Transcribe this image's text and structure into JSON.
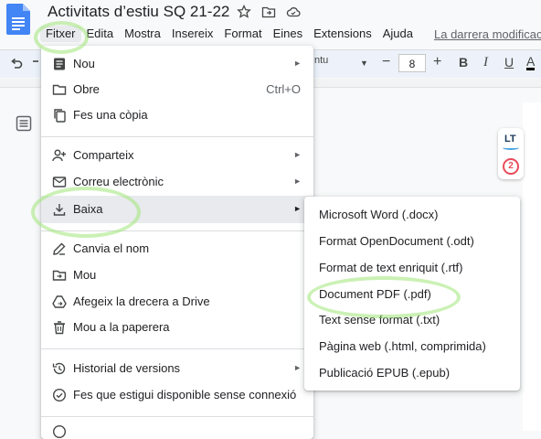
{
  "doc": {
    "title": "Activitats d’estiu SQ 21-22",
    "last_edit": "La darrera modificació",
    "brand_color": "#4285f4"
  },
  "menubar": [
    "Fitxer",
    "Edita",
    "Mostra",
    "Insereix",
    "Format",
    "Eines",
    "Extensions",
    "Ajuda"
  ],
  "toolbar": {
    "font_name": "ntu",
    "font_size": "8",
    "minus": "−",
    "plus": "+",
    "bold": "B",
    "italic": "I",
    "underline": "U",
    "color": "A"
  },
  "file_menu": {
    "items": [
      {
        "label": "Nou",
        "icon": "new-doc-icon",
        "has_sub": true
      },
      {
        "label": "Obre",
        "icon": "folder-icon",
        "shortcut": "Ctrl+O"
      },
      {
        "label": "Fes una còpia",
        "icon": "copy-icon"
      },
      {
        "label": "Comparteix",
        "icon": "share-person-icon",
        "has_sub": true
      },
      {
        "label": "Correu electrònic",
        "icon": "email-icon",
        "has_sub": true
      },
      {
        "label": "Baixa",
        "icon": "download-icon",
        "has_sub": true,
        "highlighted": true
      },
      {
        "label": "Canvia el nom",
        "icon": "rename-icon"
      },
      {
        "label": "Mou",
        "icon": "move-folder-icon"
      },
      {
        "label": "Afegeix la drecera a Drive",
        "icon": "drive-shortcut-icon"
      },
      {
        "label": "Mou a la paperera",
        "icon": "trash-icon"
      },
      {
        "label": "Historial de versions",
        "icon": "history-icon",
        "has_sub": true
      },
      {
        "label": "Fes que estigui disponible sense connexió",
        "icon": "offline-icon"
      }
    ]
  },
  "download_submenu": [
    "Microsoft Word (.docx)",
    "Format OpenDocument (.odt)",
    "Format de text enriquit (.rtf)",
    "Document PDF (.pdf)",
    "Text sense format (.txt)",
    "Pàgina web (.html, comprimida)",
    "Publicació EPUB (.epub)"
  ],
  "languagetool": {
    "label": "LT",
    "count": "2"
  }
}
